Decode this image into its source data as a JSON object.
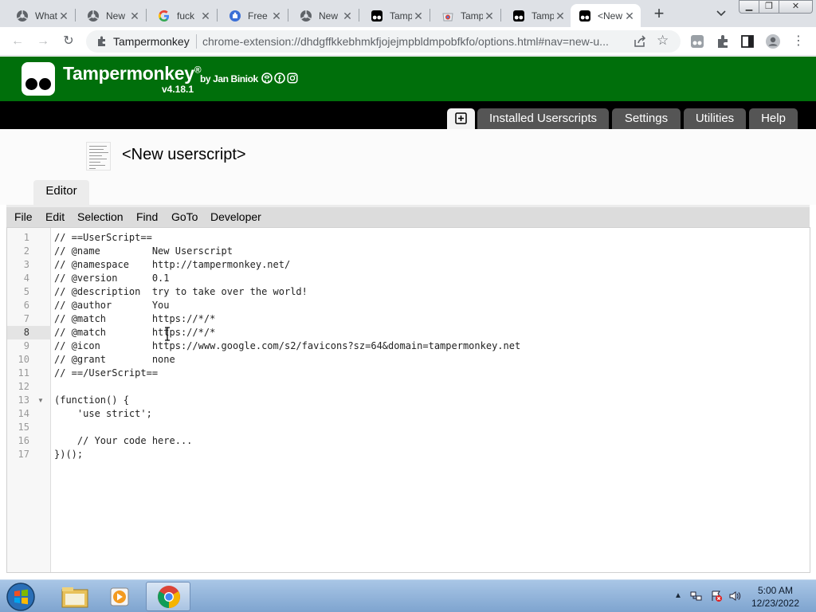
{
  "browser": {
    "tabs": [
      {
        "title": "What",
        "favicon": "github-icon"
      },
      {
        "title": "New",
        "favicon": "github-icon"
      },
      {
        "title": "fuck",
        "favicon": "google-icon"
      },
      {
        "title": "Free",
        "favicon": "puzzle-icon"
      },
      {
        "title": "New",
        "favicon": "github-icon"
      },
      {
        "title": "Tamp",
        "favicon": "tampermonkey-icon"
      },
      {
        "title": "Tamp",
        "favicon": "chrome-webstore-icon"
      },
      {
        "title": "Tamp",
        "favicon": "tampermonkey-icon"
      },
      {
        "title": "<New",
        "favicon": "tampermonkey-icon",
        "active": true
      }
    ],
    "new_tab_label": "+",
    "omnibox": {
      "origin": "Tampermonkey",
      "url": "chrome-extension://dhdgffkkebhmkfjojejmpbldmpobfkfo/options.html#nav=new-u..."
    }
  },
  "tampermonkey": {
    "title": "Tampermonkey",
    "registered": "®",
    "author": "by Jan Biniok",
    "version": "v4.18.1",
    "nav": {
      "new_script_icon": "plus-square-icon",
      "tabs": [
        "Installed Userscripts",
        "Settings",
        "Utilities",
        "Help"
      ]
    },
    "script_title": "<New userscript>",
    "editor_tab": "Editor",
    "menu": [
      "File",
      "Edit",
      "Selection",
      "Find",
      "GoTo",
      "Developer"
    ]
  },
  "code": {
    "current_line": 8,
    "fold_lines": [
      13
    ],
    "lines": [
      "// ==UserScript==",
      "// @name         New Userscript",
      "// @namespace    http://tampermonkey.net/",
      "// @version      0.1",
      "// @description  try to take over the world!",
      "// @author       You",
      "// @match        https://*/*",
      "// @match        https://*/*",
      "// @icon         https://www.google.com/s2/favicons?sz=64&domain=tampermonkey.net",
      "// @grant        none",
      "// ==/UserScript==",
      "",
      "(function() {",
      "    'use strict';",
      "",
      "    // Your code here...",
      "})();"
    ]
  },
  "taskbar": {
    "apps": [
      "file-explorer-icon",
      "media-player-icon",
      "chrome-icon"
    ],
    "time": "5:00 AM",
    "date": "12/23/2022"
  },
  "colors": {
    "tm_green": "#006f0b",
    "nav_black": "#000000",
    "nav_tab": "#555555"
  }
}
